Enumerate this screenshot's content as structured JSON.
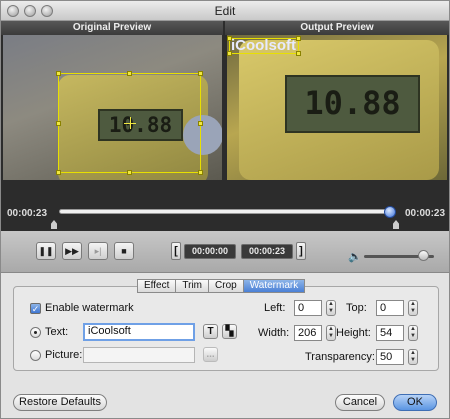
{
  "window": {
    "title": "Edit"
  },
  "preview": {
    "original_label": "Original Preview",
    "output_label": "Output Preview",
    "lcd_text": "10.88",
    "watermark_text": "iCoolsoft"
  },
  "timeline": {
    "current_time": "00:00:23",
    "end_time": "00:00:23",
    "progress": 1.0
  },
  "playback": {
    "start_time": "00:00:00",
    "end_time": "00:00:23",
    "volume_level": 0.85
  },
  "tabs": [
    {
      "label": "Effect"
    },
    {
      "label": "Trim"
    },
    {
      "label": "Crop"
    },
    {
      "label": "Watermark"
    }
  ],
  "active_tab": "Watermark",
  "watermark": {
    "enable_label": "Enable watermark",
    "enabled": true,
    "text_label": "Text:",
    "text_value": "iCoolsoft",
    "picture_label": "Picture:",
    "picture_value": "",
    "browse_label": "...",
    "left_label": "Left:",
    "left_value": "0",
    "top_label": "Top:",
    "top_value": "0",
    "width_label": "Width:",
    "width_value": "206",
    "height_label": "Height:",
    "height_value": "54",
    "transparency_label": "Transparency:",
    "transparency_value": "50",
    "font_btn": "T"
  },
  "footer": {
    "restore_label": "Restore Defaults",
    "cancel_label": "Cancel",
    "ok_label": "OK"
  }
}
